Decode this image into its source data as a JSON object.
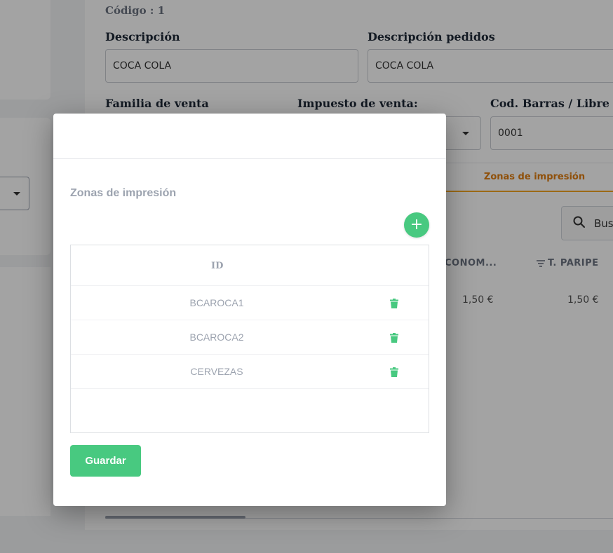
{
  "form": {
    "codigo": "Código : 1",
    "descripcion_label": "Descripción",
    "descripcion_value": "COCA COLA",
    "descripcion_pedidos_label": "Descripción pedidos",
    "descripcion_pedidos_value": "COCA COLA",
    "familia_label": "Familia de venta",
    "impuesto_label": "Impuesto de venta:",
    "barras_label": "Cod. Barras / Libre",
    "barras_value": "0001"
  },
  "tabs": {
    "active_label": "Zonas de impresión"
  },
  "search": {
    "placeholder": "Busc"
  },
  "table_bg": {
    "columns": [
      "CONOM...",
      "T. PARIPE"
    ],
    "row": [
      "1,50 €",
      "1,50 €"
    ]
  },
  "modal": {
    "title": "Zonas de impresión",
    "add_label": "+",
    "id_header": "ID",
    "rows": [
      {
        "id": "BCAROCA1"
      },
      {
        "id": "BCAROCA2"
      },
      {
        "id": "CERVEZAS"
      }
    ],
    "save_label": "Guardar"
  },
  "colors": {
    "accent_green": "#48c980",
    "tab_orange": "#e07d10"
  },
  "icons": [
    "search-icon",
    "filter-icon",
    "trash-icon",
    "chevron-down-icon",
    "plus-icon"
  ]
}
